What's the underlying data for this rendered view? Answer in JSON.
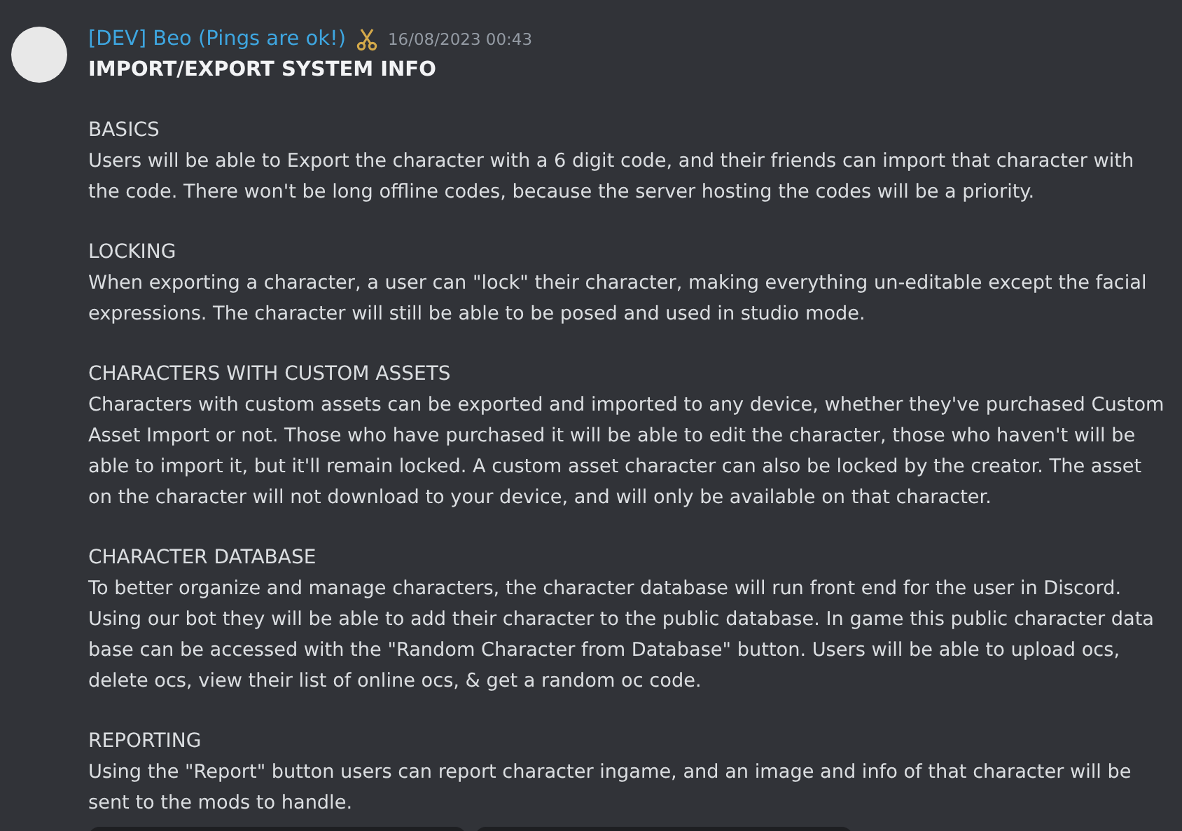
{
  "message": {
    "author": "[DEV] Beo (Pings are ok!)",
    "timestamp": "16/08/2023 00:43",
    "title": "IMPORT/EXPORT SYSTEM INFO",
    "sections": [
      {
        "heading": "BASICS",
        "text": "Users will be able to Export the character with a 6 digit code, and their friends can import that character with the code. There won't be long offline codes, because the server hosting the codes will be a priority."
      },
      {
        "heading": "LOCKING",
        "text": "When exporting a character, a user can \"lock\" their character, making everything un-editable except the facial expressions. The character will still be able to be posed and used in studio mode."
      },
      {
        "heading": "CHARACTERS WITH CUSTOM ASSETS",
        "text": "Characters with custom assets can be exported and imported to any device, whether they've purchased Custom Asset Import or not. Those who have purchased it will be able to edit the character, those who haven't will be able to import it, but it'll remain locked. A custom asset character can also be locked by the creator. The asset on the character will not download to your device, and will only be available on that character."
      },
      {
        "heading": "CHARACTER DATABASE",
        "text": "To better organize and manage characters, the character database will run front end for the user in Discord. Using our bot they will be able to add their character to the public database. In game this public character data base can be accessed with the \"Random Character from Database\" button. Users will be able to upload ocs, delete ocs, view their list of online ocs, & get a random oc code."
      },
      {
        "heading": "REPORTING",
        "text": "Using the \"Report\" button users can report character ingame, and an image and info of that character will be sent to the mods to handle."
      }
    ],
    "attachments": [
      {
        "kind": "image"
      },
      {
        "kind": "image"
      }
    ]
  }
}
